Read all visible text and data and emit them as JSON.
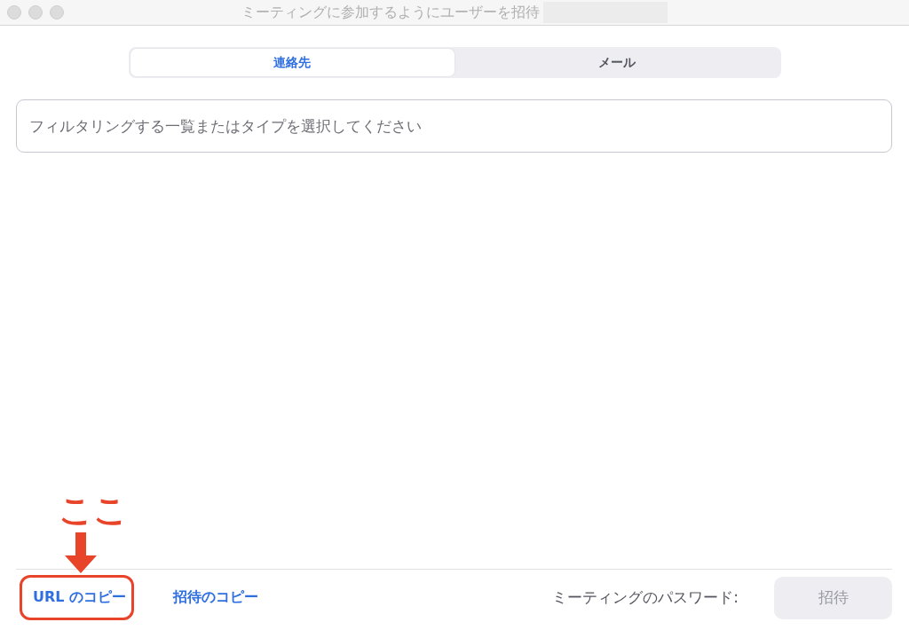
{
  "window": {
    "title": "ミーティングに参加するようにユーザーを招待"
  },
  "tabs": [
    {
      "label": "連絡先",
      "selected": true
    },
    {
      "label": "メール",
      "selected": false
    }
  ],
  "search": {
    "placeholder": "フィルタリングする一覧またはタイプを選択してください"
  },
  "footer": {
    "copy_url": "URL のコピー",
    "copy_invite": "招待のコピー",
    "password_label": "ミーティングのパスワード:",
    "invite_button": {
      "label": "招待",
      "disabled": true
    }
  },
  "annotation": {
    "label": "ここ"
  }
}
